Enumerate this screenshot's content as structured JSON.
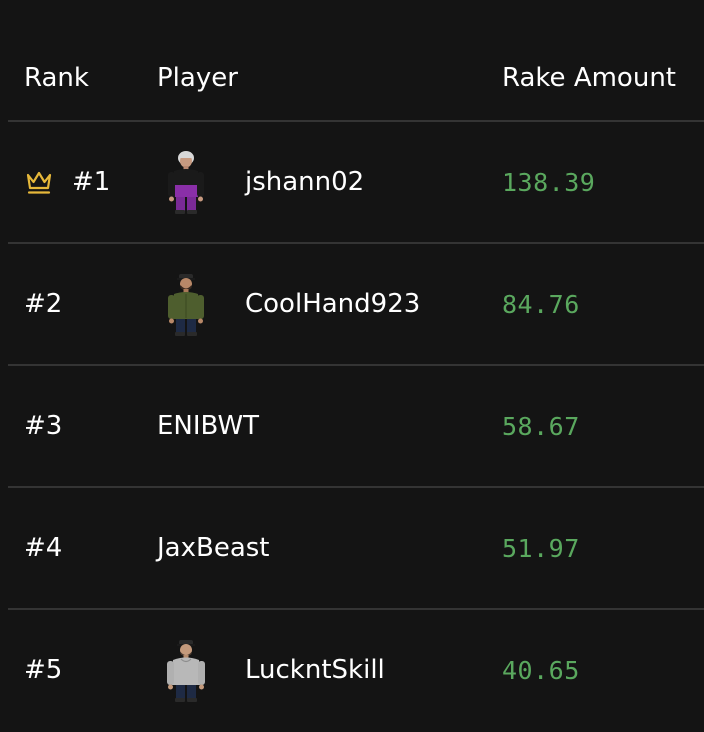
{
  "colors": {
    "background": "#141414",
    "divider": "#343434",
    "text": "#ffffff",
    "rake_green": "#5aa85e",
    "crown_gold": "#e6b83a"
  },
  "header": {
    "rank": "Rank",
    "player": "Player",
    "rake": "Rake Amount"
  },
  "rows": [
    {
      "rank": "#1",
      "player": "jshann02",
      "rake": "138.39",
      "crown": true,
      "avatar": "avatar-purple-shirt-icon"
    },
    {
      "rank": "#2",
      "player": "CoolHand923",
      "rake": "84.76",
      "crown": false,
      "avatar": "avatar-green-shirt-icon"
    },
    {
      "rank": "#3",
      "player": "ENIBWT",
      "rake": "58.67",
      "crown": false,
      "avatar": null
    },
    {
      "rank": "#4",
      "player": "JaxBeast",
      "rake": "51.97",
      "crown": false,
      "avatar": null
    },
    {
      "rank": "#5",
      "player": "LuckntSkill",
      "rake": "40.65",
      "crown": false,
      "avatar": "avatar-grey-hoodie-icon"
    }
  ]
}
